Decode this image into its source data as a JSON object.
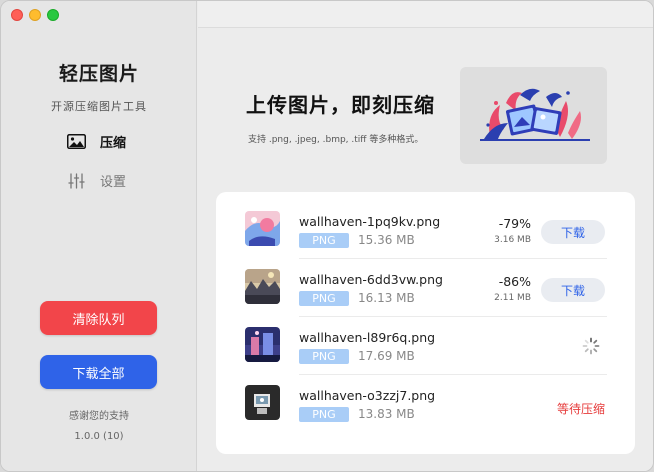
{
  "sidebar": {
    "app_title": "轻压图片",
    "app_subtitle": "开源压缩图片工具",
    "nav": [
      {
        "label": "压缩",
        "icon": "image-icon",
        "active": true
      },
      {
        "label": "设置",
        "icon": "sliders-icon",
        "active": false
      }
    ],
    "clear_label": "清除队列",
    "download_all_label": "下载全部",
    "thanks": "感谢您的支持",
    "version": "1.0.0 (10)",
    "colors": {
      "clear": "#f2454a",
      "download_all": "#2f63e8"
    }
  },
  "upload": {
    "title": "上传图片，即刻压缩",
    "hint": "支持 .png, .jpeg, .bmp, .tiff 等多种格式。"
  },
  "queue": [
    {
      "name": "wallhaven-1pq9kv.png",
      "type": "PNG",
      "size": "15.36 MB",
      "percent": "-79%",
      "new_size": "3.16 MB",
      "action": "下载",
      "status": "done"
    },
    {
      "name": "wallhaven-6dd3vw.png",
      "type": "PNG",
      "size": "16.13 MB",
      "percent": "-86%",
      "new_size": "2.11 MB",
      "action": "下载",
      "status": "done"
    },
    {
      "name": "wallhaven-l89r6q.png",
      "type": "PNG",
      "size": "17.69 MB",
      "status": "processing"
    },
    {
      "name": "wallhaven-o3zzj7.png",
      "type": "PNG",
      "size": "13.83 MB",
      "status": "waiting",
      "status_text": "等待压缩"
    }
  ]
}
